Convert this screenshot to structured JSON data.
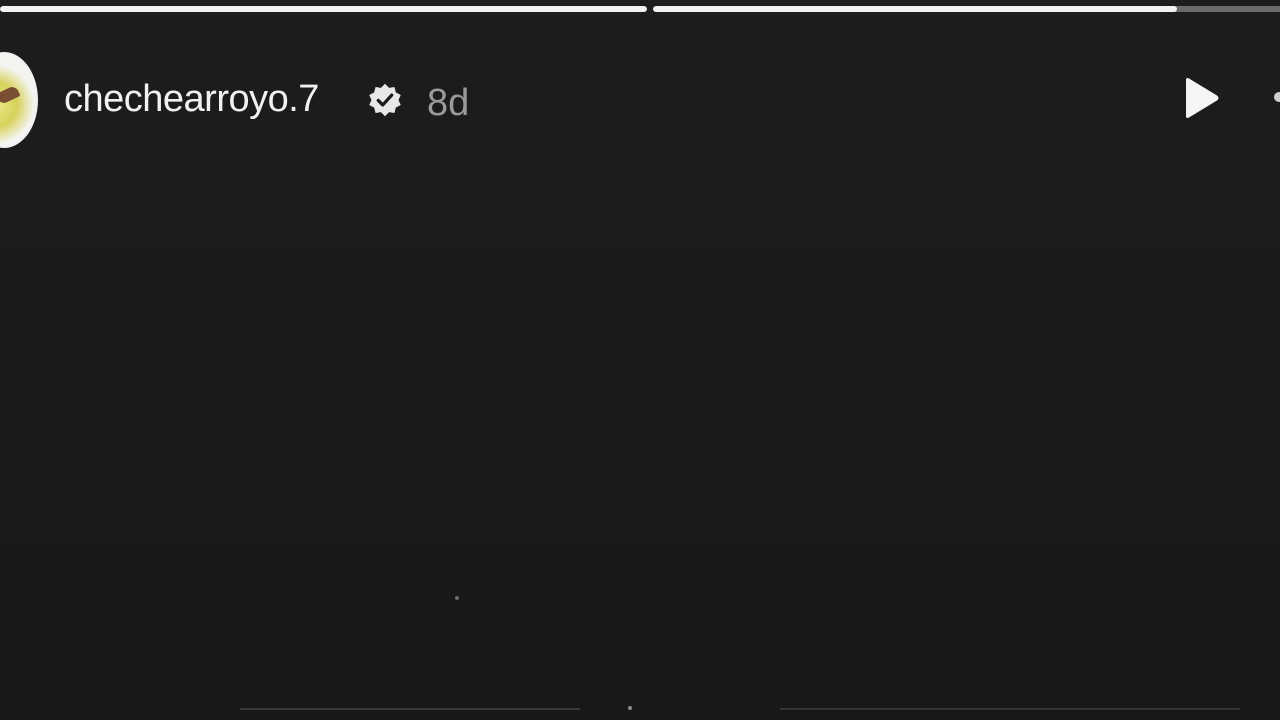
{
  "story": {
    "username": "chechearroyo.7",
    "time_ago": "8d",
    "progress": [
      1.0,
      0.81
    ],
    "colors": {
      "background": "#1b1b1b",
      "progress_fill": "#f2f2f2",
      "progress_track": "rgba(255,255,255,0.35)",
      "time_text": "#9a9a9a"
    },
    "icons": {
      "verified": "verified-badge-icon",
      "play": "play-icon"
    }
  }
}
